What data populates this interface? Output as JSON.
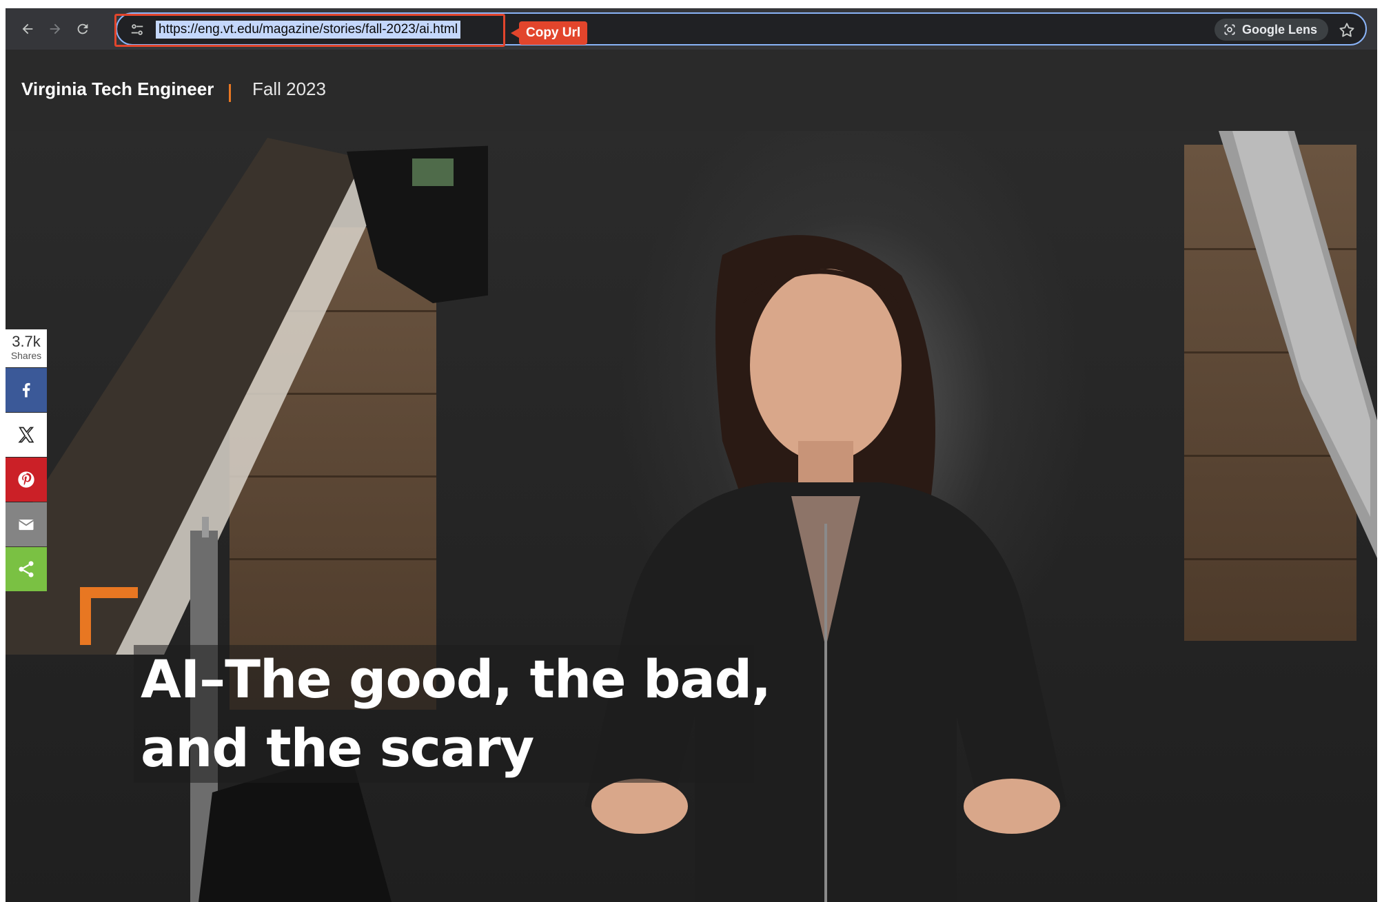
{
  "browser": {
    "url": "https://eng.vt.edu/magazine/stories/fall-2023/ai.html",
    "lens_label": "Google Lens",
    "icons": [
      "back-arrow-icon",
      "forward-arrow-icon",
      "reload-icon",
      "site-settings-icon",
      "google-lens-icon",
      "bookmark-star-icon"
    ]
  },
  "annotation": {
    "tag": "Copy Url",
    "color": "#e2452c"
  },
  "site": {
    "title": "Virginia Tech Engineer",
    "issue": "Fall 2023",
    "accent": "#e87722"
  },
  "share": {
    "count": "3.7k",
    "caption": "Shares",
    "buttons": [
      {
        "name": "facebook",
        "icon": "facebook-icon",
        "color": "#3b5998"
      },
      {
        "name": "x",
        "icon": "x-icon",
        "color": "#ffffff"
      },
      {
        "name": "pinterest",
        "icon": "pinterest-icon",
        "color": "#cb2027"
      },
      {
        "name": "email",
        "icon": "mail-icon",
        "color": "#848484"
      },
      {
        "name": "share",
        "icon": "share-icon",
        "color": "#7ac143"
      }
    ]
  },
  "hero": {
    "headline": [
      "AI–The good, the bad,",
      "and the scary"
    ]
  }
}
